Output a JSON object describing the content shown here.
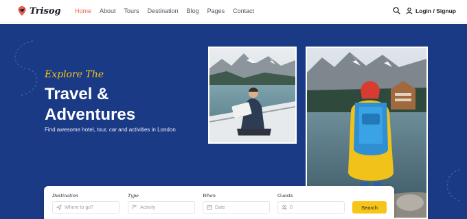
{
  "brand": {
    "name": "Trisog"
  },
  "nav": {
    "items": [
      {
        "label": "Home",
        "active": true
      },
      {
        "label": "About"
      },
      {
        "label": "Tours"
      },
      {
        "label": "Destination"
      },
      {
        "label": "Blog"
      },
      {
        "label": "Pages"
      },
      {
        "label": "Contact"
      }
    ],
    "login_label": "Login / Signup",
    "search_icon": "search-icon",
    "user_icon": "user-icon"
  },
  "hero": {
    "tagline": "Explore The",
    "title": "Travel & Adventures",
    "subtitle": "Find awesome hotel, tour, car and activities in London"
  },
  "search": {
    "fields": [
      {
        "label": "Destination",
        "placeholder": "Where to go?",
        "icon": "send-icon"
      },
      {
        "label": "Type",
        "placeholder": "Activity",
        "icon": "flag-icon"
      },
      {
        "label": "When",
        "placeholder": "Date",
        "icon": "calendar-icon"
      },
      {
        "label": "Guests",
        "placeholder": "0",
        "icon": "guests-icon"
      }
    ],
    "button_label": "Search"
  },
  "colors": {
    "hero_bg": "#1b3a86",
    "accent": "#f5c518",
    "active_link": "#e8604c"
  }
}
